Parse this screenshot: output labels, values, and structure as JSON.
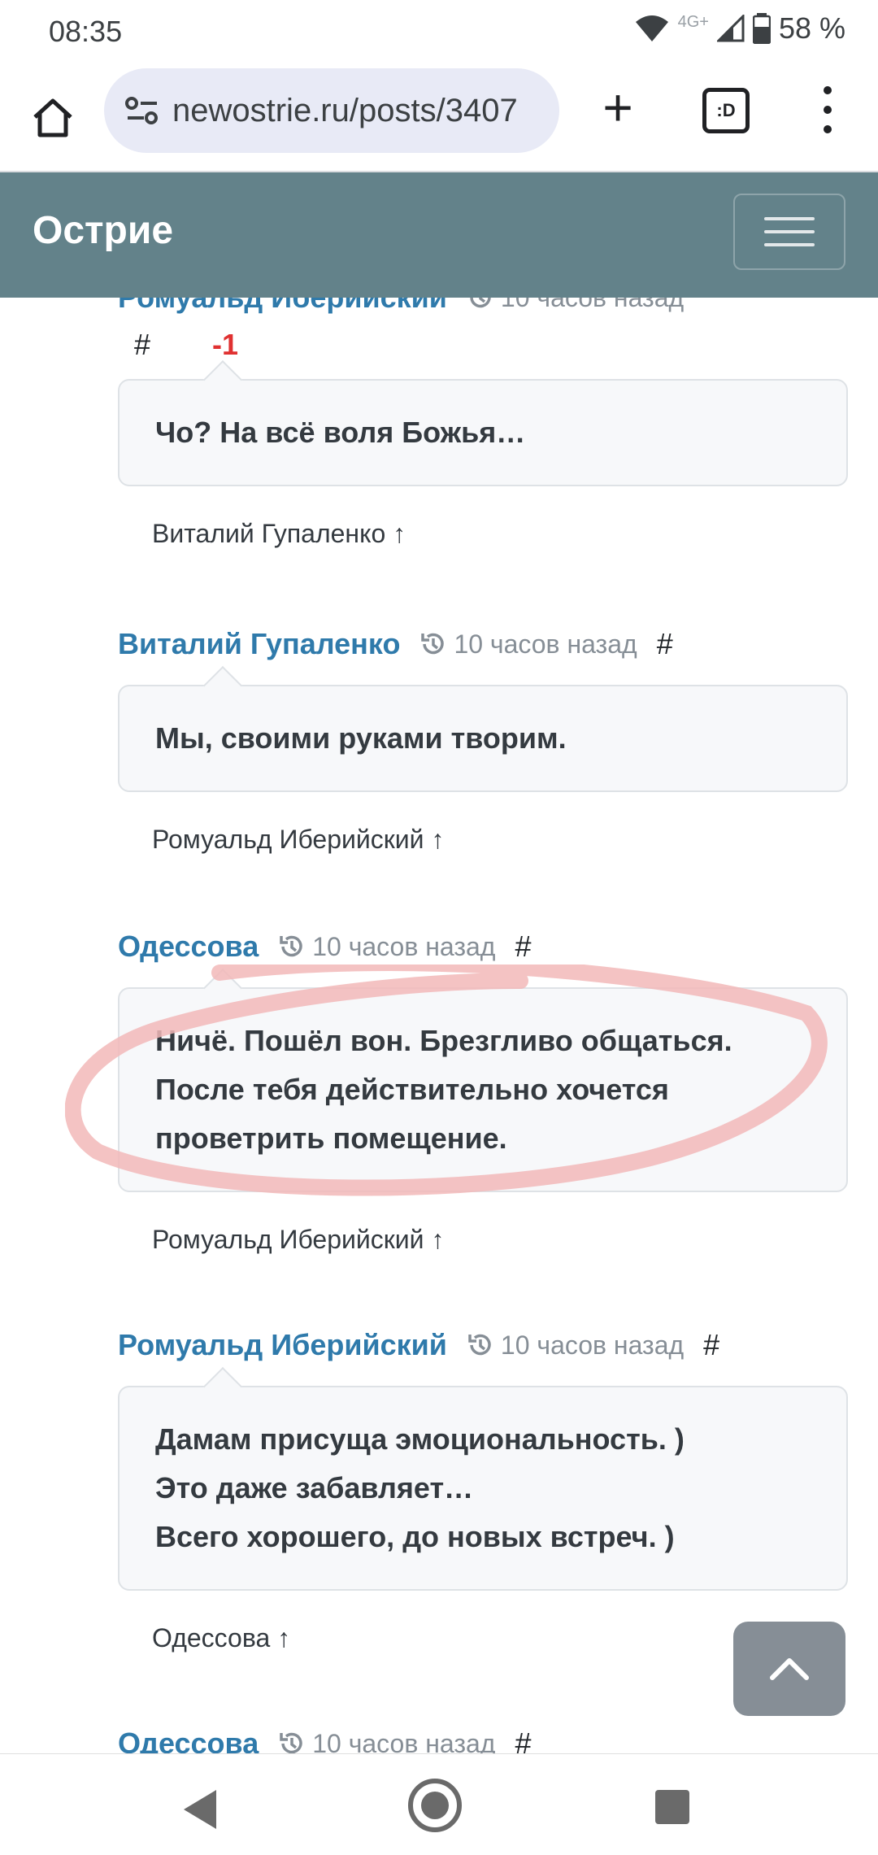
{
  "status_bar": {
    "time": "08:35",
    "network": "4G+",
    "battery": "58 %"
  },
  "browser": {
    "url": "newostrie.ru/posts/3407",
    "tabs_icon_text": ":D"
  },
  "site": {
    "brand": "Острие"
  },
  "comments": [
    {
      "author": "Ромуальд Иберийский",
      "time": "10 часов назад",
      "hash": "#",
      "vote": "-1",
      "text_lines": [
        "Чо? На всё воля Божья…"
      ],
      "reply_to": "Виталий Гупаленко ↑"
    },
    {
      "author": "Виталий Гупаленко",
      "time": "10 часов назад",
      "hash": "#",
      "text_lines": [
        "Мы, своими руками творим."
      ],
      "reply_to": "Ромуальд Иберийский ↑"
    },
    {
      "author": "Одессова",
      "time": "10 часов назад",
      "hash": "#",
      "text_lines": [
        "Ничё. Пошёл вон. Брезгливо общаться.",
        "После тебя действительно хочется",
        "проветрить помещение."
      ],
      "reply_to": "Ромуальд Иберийский ↑",
      "highlighted": true
    },
    {
      "author": "Ромуальд Иберийский",
      "time": "10 часов назад",
      "hash": "#",
      "text_lines": [
        "Дамам присуща эмоциональность. )",
        "Это даже забавляет…",
        "Всего хорошего, до новых встреч. )"
      ],
      "reply_to": "Одессова ↑"
    },
    {
      "author": "Одессова",
      "time": "10 часов назад",
      "hash": "#"
    }
  ],
  "colors": {
    "header_bg": "#63828a",
    "author_link": "#2f7aab",
    "vote_negative": "#e03131",
    "highlight_stroke": "#f2b8b8"
  },
  "icons": [
    "home-icon",
    "site-info-icon",
    "plus-icon",
    "tabs-icon",
    "more-vert-icon",
    "menu-icon",
    "history-icon",
    "chevron-up-icon",
    "nav-back-icon",
    "nav-home-icon",
    "nav-recents-icon"
  ]
}
